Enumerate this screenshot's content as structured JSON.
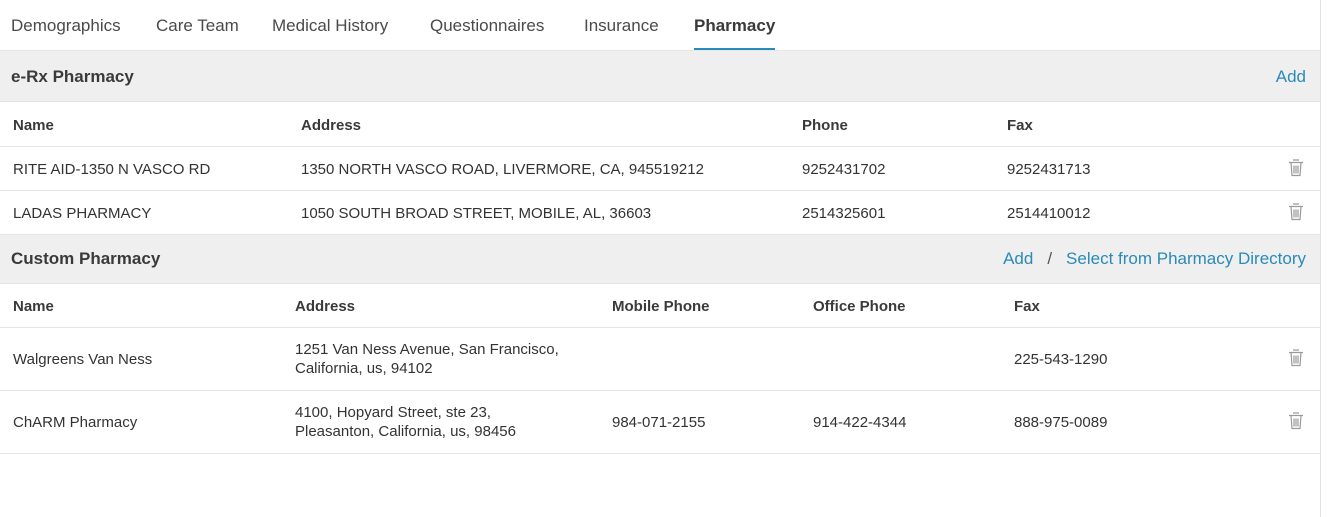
{
  "tabs": [
    {
      "label": "Demographics",
      "active": false
    },
    {
      "label": "Care Team",
      "active": false
    },
    {
      "label": "Medical History",
      "active": false
    },
    {
      "label": "Questionnaires",
      "active": false
    },
    {
      "label": "Insurance",
      "active": false
    },
    {
      "label": "Pharmacy",
      "active": true
    }
  ],
  "erx": {
    "title": "e-Rx Pharmacy",
    "add_label": "Add",
    "columns": [
      "Name",
      "Address",
      "Phone",
      "Fax"
    ],
    "rows": [
      {
        "name": "RITE AID-1350 N VASCO RD",
        "address": "1350 NORTH VASCO ROAD,  LIVERMORE,  CA,  945519212",
        "phone": "9252431702",
        "fax": "9252431713"
      },
      {
        "name": "LADAS PHARMACY",
        "address": "1050 SOUTH BROAD STREET,  MOBILE,  AL,  36603",
        "phone": "2514325601",
        "fax": "2514410012"
      }
    ]
  },
  "custom": {
    "title": "Custom Pharmacy",
    "add_label": "Add",
    "separator": "/",
    "directory_label": "Select from Pharmacy Directory",
    "columns": [
      "Name",
      "Address",
      "Mobile Phone",
      "Office Phone",
      "Fax"
    ],
    "rows": [
      {
        "name": "Walgreens Van Ness",
        "address": "1251 Van Ness Avenue,  San Francisco,\nCalifornia,  us,  94102",
        "mobile": "",
        "office": "",
        "fax": "225-543-1290"
      },
      {
        "name": "ChARM Pharmacy",
        "address": "4100, Hopyard Street,  ste 23,\nPleasanton,  California,  us,  98456",
        "mobile": "984-071-2155",
        "office": "914-422-4344",
        "fax": "888-975-0089"
      }
    ]
  },
  "colors": {
    "accent": "#2a8ab8",
    "header_bg": "#efefef",
    "icon": "#9a9a9a"
  },
  "icons": {
    "row_action": "trash-icon"
  }
}
